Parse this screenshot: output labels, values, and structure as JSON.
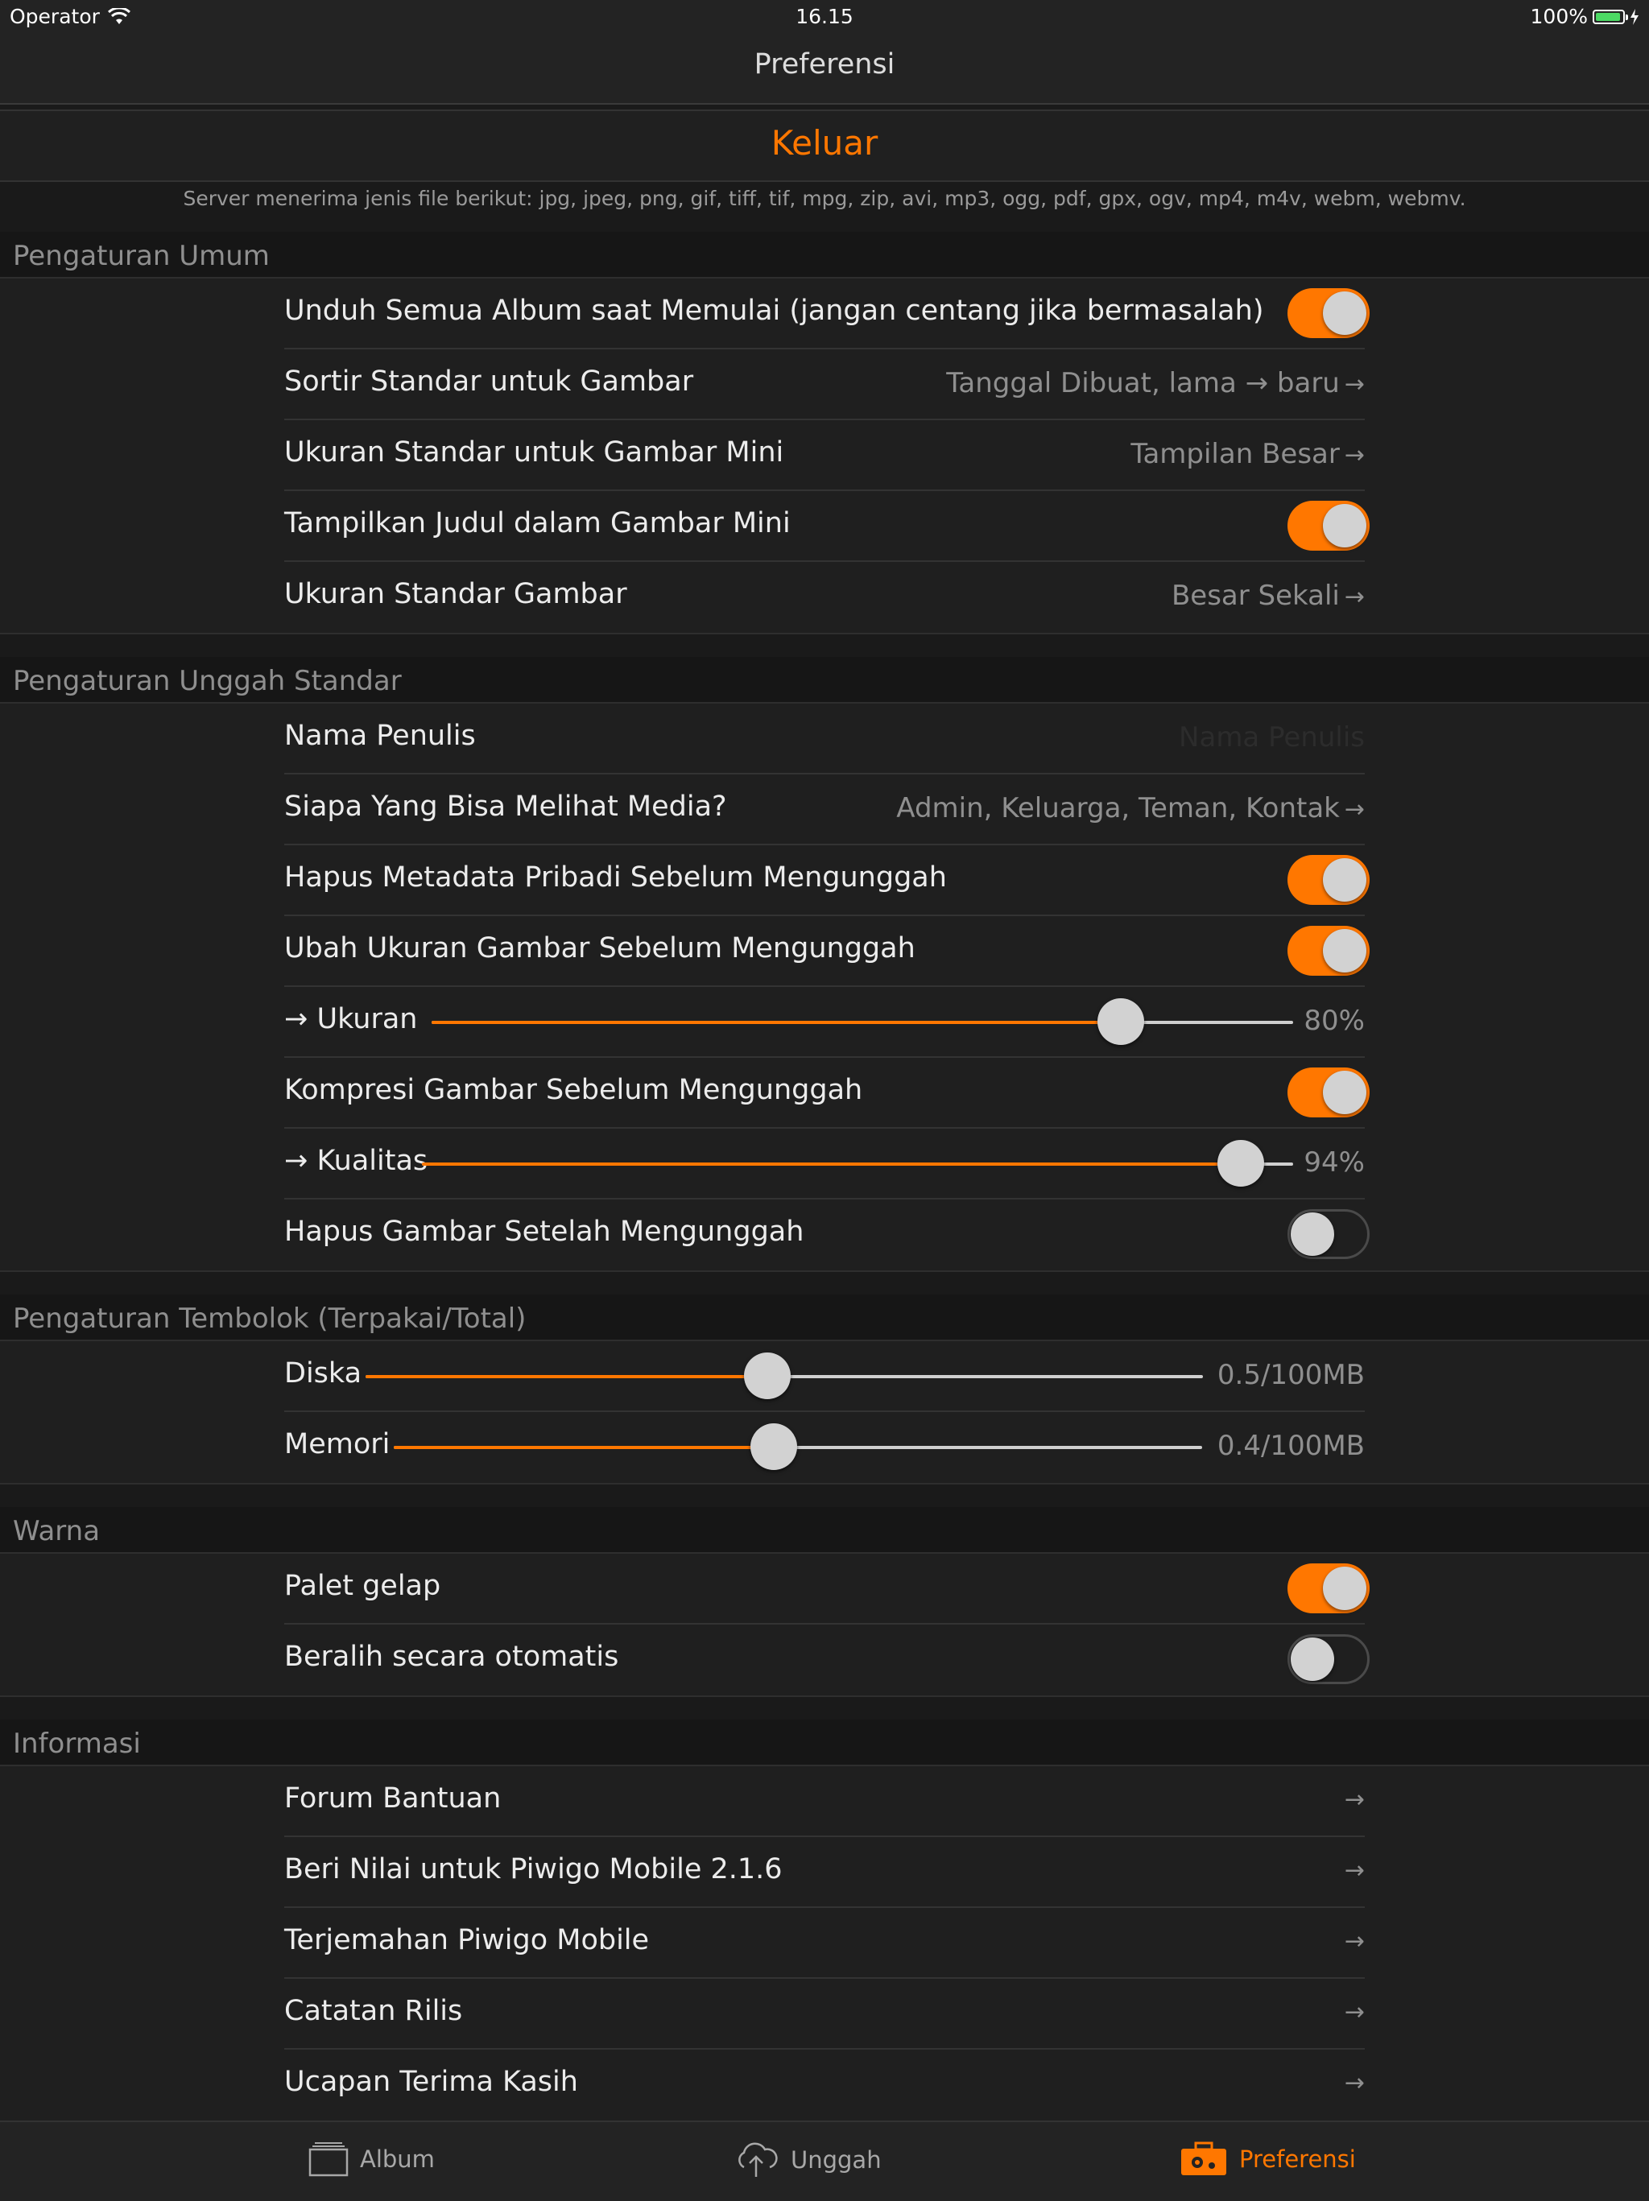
{
  "status_bar": {
    "carrier": "Operator",
    "time": "16.15",
    "battery": "100%"
  },
  "nav": {
    "title": "Preferensi"
  },
  "logout_label": "Keluar",
  "server_note": "Server menerima jenis file berikut: jpg, jpeg, png, gif, tiff, tif, mpg, zip, avi, mp3, ogg, pdf, gpx, ogv, mp4, m4v, webm, webmv.",
  "general": {
    "header": "Pengaturan Umum",
    "download_all": {
      "label": "Unduh Semua Album saat Memulai (jangan centang jika bermasalah)",
      "on": true
    },
    "sort": {
      "label": "Sortir Standar untuk Gambar",
      "value": "Tanggal Dibuat, lama → baru"
    },
    "thumb_size": {
      "label": "Ukuran Standar untuk Gambar Mini",
      "value": "Tampilan Besar"
    },
    "show_titles": {
      "label": "Tampilkan Judul dalam Gambar Mini",
      "on": true
    },
    "image_size": {
      "label": "Ukuran Standar Gambar",
      "value": "Besar Sekali"
    }
  },
  "upload": {
    "header": "Pengaturan Unggah Standar",
    "author": {
      "label": "Nama Penulis",
      "placeholder": "Nama Penulis"
    },
    "privacy": {
      "label": "Siapa Yang Bisa Melihat Media?",
      "value": "Admin, Keluarga, Teman, Kontak"
    },
    "strip_metadata": {
      "label": "Hapus Metadata Pribadi Sebelum Mengunggah",
      "on": true
    },
    "resize": {
      "label": "Ubah Ukuran Gambar Sebelum Mengunggah",
      "on": true
    },
    "resize_size": {
      "label": "→ Ukuran",
      "value": "80%",
      "fraction": 0.8
    },
    "compress": {
      "label": "Kompresi Gambar Sebelum Mengunggah",
      "on": true
    },
    "quality": {
      "label": "→ Kualitas",
      "value": "94%",
      "fraction": 0.94
    },
    "delete_after": {
      "label": "Hapus Gambar Setelah Mengunggah",
      "on": false
    }
  },
  "cache": {
    "header": "Pengaturan Tembolok (Terpakai/Total)",
    "disk": {
      "label": "Diska",
      "value": "0.5/100MB",
      "fraction": 0.48
    },
    "memory": {
      "label": "Memori",
      "value": "0.4/100MB",
      "fraction": 0.47
    }
  },
  "color": {
    "header": "Warna",
    "dark_palette": {
      "label": "Palet gelap",
      "on": true
    },
    "auto_switch": {
      "label": "Beralih secara otomatis",
      "on": false
    }
  },
  "info": {
    "header": "Informasi",
    "items": [
      {
        "label": "Forum Bantuan"
      },
      {
        "label": "Beri Nilai untuk Piwigo Mobile 2.1.6"
      },
      {
        "label": "Terjemahan Piwigo Mobile"
      },
      {
        "label": "Catatan Rilis"
      },
      {
        "label": "Ucapan Terima Kasih"
      }
    ]
  },
  "arrow_glyph": "→",
  "tabs": [
    {
      "label": "Album",
      "icon": "album-icon"
    },
    {
      "label": "Unggah",
      "icon": "upload-cloud-icon"
    },
    {
      "label": "Preferensi",
      "icon": "preferences-toolbox-icon",
      "active": true
    }
  ],
  "colors": {
    "accent": "#ff7700",
    "background": "#1a1a1a",
    "row": "#1f1f1f",
    "muted_text": "#8f8f8f"
  }
}
